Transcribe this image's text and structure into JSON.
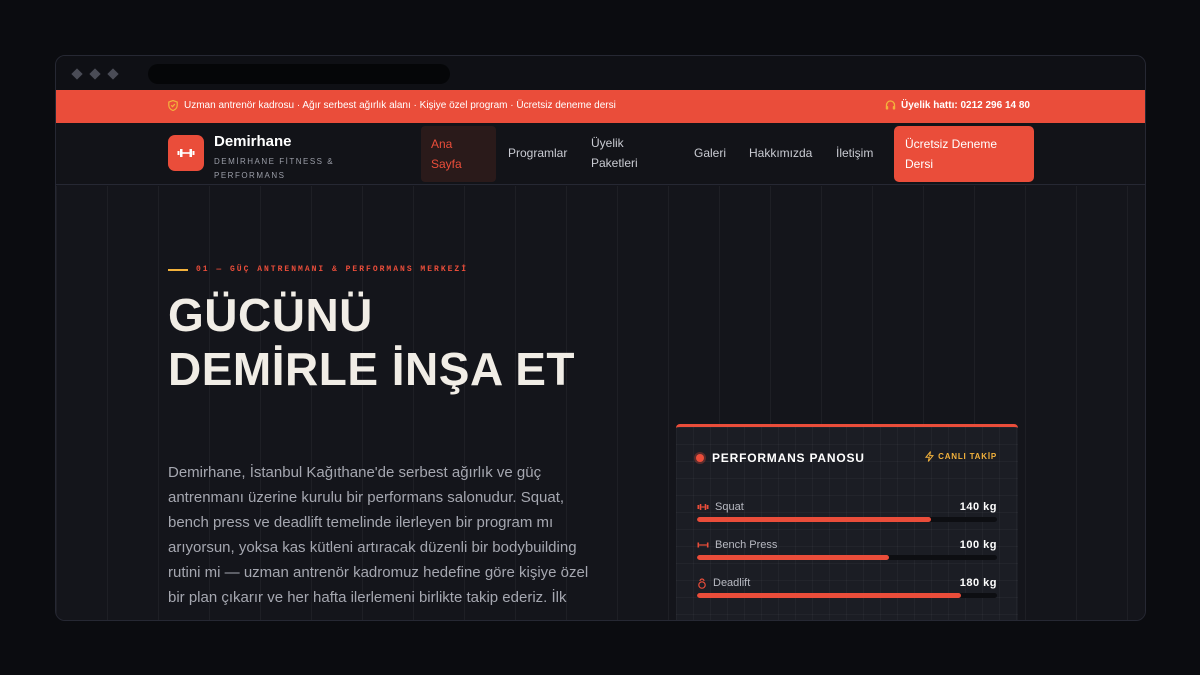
{
  "topbar": {
    "info": "Uzman antrenör kadrosu · Ağır serbest ağırlık alanı · Kişiye özel program · Ücretsiz deneme dersi",
    "hotline": "Üyelik hattı: 0212 296 14 80"
  },
  "brand": {
    "name": "Demirhane",
    "tagline": "DEMİRHANE FİTNESS & PERFORMANS"
  },
  "nav": {
    "items": [
      {
        "label": "Ana Sayfa"
      },
      {
        "label": "Programlar"
      },
      {
        "label": "Üyelik Paketleri"
      },
      {
        "label": "Galeri"
      },
      {
        "label": "Hakkımızda"
      },
      {
        "label": "İletişim"
      }
    ],
    "cta": "Ücretsiz Deneme Dersi"
  },
  "hero": {
    "eyebrow": "01 — GÜÇ ANTRENMANI & PERFORMANS MERKEZİ",
    "headline": "GÜCÜNÜ DEMİRLE İNŞA ET",
    "lead": "Demirhane, İstanbul Kağıthane'de serbest ağırlık ve güç antrenmanı üzerine kurulu bir performans salonudur. Squat, bench press ve deadlift temelinde ilerleyen bir program mı arıyorsun, yoksa kas kütleni artıracak düzenli bir bodybuilding rutini mi — uzman antrenör kadromuz hedefine göre kişiye özel bir plan çıkarır ve her hafta ilerlemeni birlikte takip ederiz. İlk"
  },
  "panel": {
    "title": "PERFORMANS PANOSU",
    "live": "CANLI TAKİP",
    "stats": [
      {
        "name": "Squat",
        "value": "140 kg",
        "progress": 0.78
      },
      {
        "name": "Bench Press",
        "value": "100 kg",
        "progress": 0.64
      },
      {
        "name": "Deadlift",
        "value": "180 kg",
        "progress": 0.88
      }
    ]
  },
  "colors": {
    "accent": "#ea4d3a",
    "gold": "#f3b23c",
    "background": "#14151b"
  }
}
